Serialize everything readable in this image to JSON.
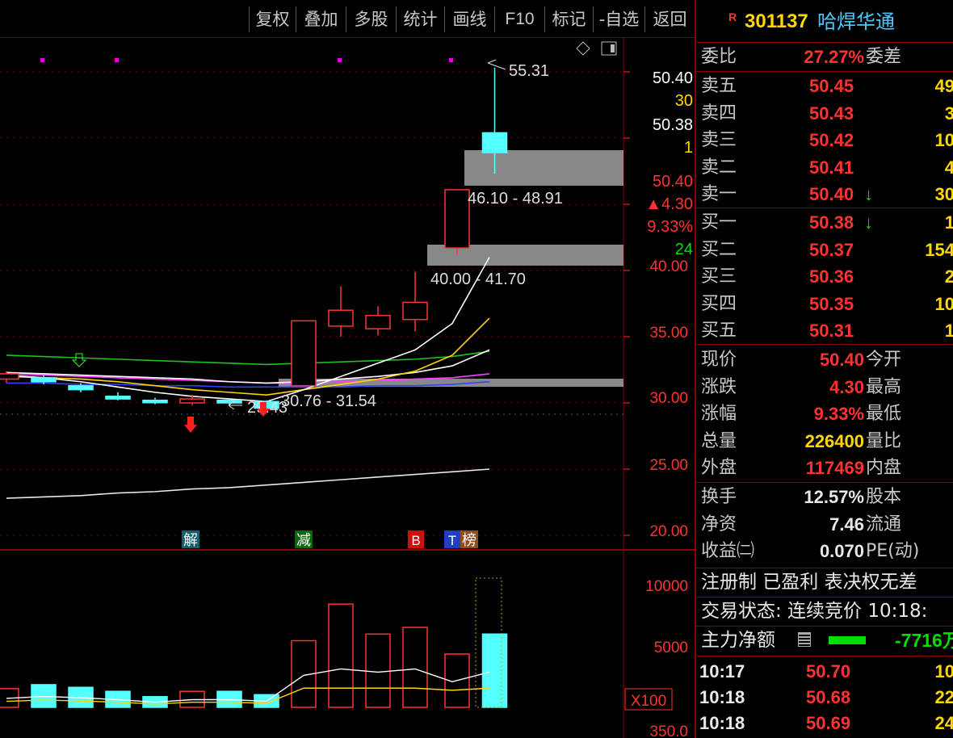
{
  "toolbar": {
    "buttons": [
      "复权",
      "叠加",
      "多股",
      "统计",
      "画线",
      "F10",
      "标记",
      "-自选",
      "返回"
    ]
  },
  "header": {
    "marker": "R",
    "code": "301137",
    "name": "哈焊华通"
  },
  "ratio": {
    "label": "委比",
    "value": "27.27%",
    "label2": "委差"
  },
  "asks": [
    {
      "label": "卖五",
      "price": "50.45",
      "vol": "49"
    },
    {
      "label": "卖四",
      "price": "50.43",
      "vol": "3"
    },
    {
      "label": "卖三",
      "price": "50.42",
      "vol": "10"
    },
    {
      "label": "卖二",
      "price": "50.41",
      "vol": "4"
    },
    {
      "label": "卖一",
      "price": "50.40",
      "vol": "30",
      "arrow": "↓"
    }
  ],
  "bids": [
    {
      "label": "买一",
      "price": "50.38",
      "vol": "1",
      "arrow": "↓"
    },
    {
      "label": "买二",
      "price": "50.37",
      "vol": "154"
    },
    {
      "label": "买三",
      "price": "50.36",
      "vol": "2"
    },
    {
      "label": "买四",
      "price": "50.35",
      "vol": "10"
    },
    {
      "label": "买五",
      "price": "50.31",
      "vol": "1"
    }
  ],
  "quote": [
    {
      "l1": "现价",
      "v": "50.40",
      "l2": "今开",
      "color": "red"
    },
    {
      "l1": "涨跌",
      "v": "4.30",
      "l2": "最高",
      "color": "red"
    },
    {
      "l1": "涨幅",
      "v": "9.33%",
      "l2": "最低",
      "color": "red"
    },
    {
      "l1": "总量",
      "v": "226400",
      "l2": "量比",
      "color": "yel"
    },
    {
      "l1": "外盘",
      "v": "117469",
      "l2": "内盘",
      "color": "red"
    }
  ],
  "fundamentals": [
    {
      "l1": "换手",
      "v": "12.57%",
      "l2": "股本"
    },
    {
      "l1": "净资",
      "v": "7.46",
      "l2": "流通"
    },
    {
      "l1": "收益㈡",
      "v": "0.070",
      "l2": "PE(动)"
    }
  ],
  "tags": "注册制 已盈利 表决权无差",
  "trade_state": "交易状态: 连续竞价 10:18:",
  "main_flow": {
    "label": "主力净额",
    "value": "-7716万"
  },
  "ticks": [
    {
      "time": "10:17",
      "price": "50.70",
      "vol": "10"
    },
    {
      "time": "10:18",
      "price": "50.68",
      "vol": "22"
    },
    {
      "time": "10:18",
      "price": "50.69",
      "vol": "24"
    }
  ],
  "chart_data": {
    "type": "candlestick",
    "price_axis": {
      "ticks": [
        "40.00",
        "35.00",
        "30.00",
        "25.00",
        "20.00"
      ],
      "values": [
        40,
        35,
        30,
        25,
        20
      ]
    },
    "volume_axis": {
      "ticks": [
        "10000",
        "5000",
        "X100",
        "350.0"
      ]
    },
    "right_labels": {
      "p1": "50.40",
      "v1": "30",
      "p2": "50.38",
      "v2": "1",
      "p3": "50.40",
      "chg": "▲4.30",
      "pct": "9.33%",
      "v3": "24"
    },
    "annotations": {
      "high": "55.31",
      "low": "29.43",
      "gap1": "46.10 - 48.91",
      "gap2": "40.00 - 41.70",
      "gap3": "30.76 - 31.54"
    },
    "event_tags": [
      "解",
      "减",
      "B",
      "T",
      "榜"
    ],
    "candles": [
      {
        "o": 31.8,
        "c": 32.2,
        "h": 32.4,
        "l": 31.5
      },
      {
        "o": 31.9,
        "c": 31.6,
        "h": 32.1,
        "l": 31.4
      },
      {
        "o": 31.3,
        "c": 31.0,
        "h": 31.5,
        "l": 30.8
      },
      {
        "o": 30.5,
        "c": 30.3,
        "h": 30.8,
        "l": 30.2
      },
      {
        "o": 30.2,
        "c": 30.1,
        "h": 30.4,
        "l": 29.9
      },
      {
        "o": 30.0,
        "c": 30.3,
        "h": 30.6,
        "l": 29.8
      },
      {
        "o": 30.2,
        "c": 30.0,
        "h": 30.3,
        "l": 29.8
      },
      {
        "o": 30.1,
        "c": 29.6,
        "h": 30.2,
        "l": 29.43
      },
      {
        "o": 31.3,
        "c": 36.2,
        "h": 36.2,
        "l": 31.2
      },
      {
        "o": 35.8,
        "c": 37.0,
        "h": 38.8,
        "l": 35.0
      },
      {
        "o": 35.6,
        "c": 36.6,
        "h": 37.3,
        "l": 35.1
      },
      {
        "o": 36.3,
        "c": 37.6,
        "h": 39.9,
        "l": 35.4
      },
      {
        "o": 41.7,
        "c": 46.1,
        "h": 46.1,
        "l": 41.2
      },
      {
        "o": 50.4,
        "c": 48.9,
        "h": 55.31,
        "l": 47.3
      }
    ],
    "volumes": [
      280,
      340,
      300,
      240,
      160,
      240,
      240,
      190,
      1000,
      1550,
      1100,
      1200,
      800,
      1100
    ]
  }
}
